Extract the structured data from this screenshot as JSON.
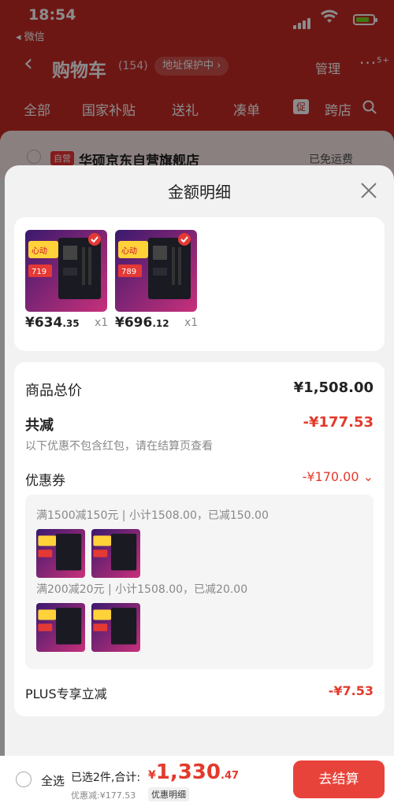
{
  "status": {
    "time": "18:54",
    "back_app": "◂ 微信"
  },
  "navbar": {
    "title": "购物车",
    "count": "(154)",
    "address_protect": "地址保护中",
    "manage": "管理",
    "more_badge": "5+"
  },
  "tabs": {
    "all": "全部",
    "national": "国家补贴",
    "gift": "送礼",
    "bundle": "凑单",
    "promo_badge": "促",
    "cross": "跨店"
  },
  "store": {
    "tag": "自营",
    "name": "华硕京东自营旗舰店",
    "shipping": "已免运费"
  },
  "sheet": {
    "title": "金额明细"
  },
  "products": [
    {
      "price_int": "¥634",
      "price_dec": ".35",
      "qty": "x1",
      "promo_price": "719"
    },
    {
      "price_int": "¥696",
      "price_dec": ".12",
      "qty": "x1",
      "promo_price": "789"
    }
  ],
  "summary": {
    "goods_total_label": "商品总价",
    "goods_total_value": "¥1,508.00",
    "discount_label": "共减",
    "discount_value": "-¥177.53",
    "note": "以下优惠不包含红包，请在结算页查看",
    "coupon_label": "优惠券",
    "coupon_value": "-¥170.00",
    "rule1": "满1500减150元 | 小计1508.00，已减150.00",
    "rule2": "满200减20元 | 小计1508.00，已减20.00",
    "plus_label": "PLUS专享立减",
    "plus_value": "-¥7.53"
  },
  "bottom": {
    "select_all": "全选",
    "selected": "已选2件,合计:",
    "currency": "¥",
    "total_int": "1,330",
    "total_dec": ".47",
    "discount_note": "优惠减:¥177.53",
    "detail": "优惠明细",
    "checkout": "去结算"
  },
  "colors": {
    "brand_red": "#c62a25",
    "price_red": "#e33a2c",
    "checkout_button": "#e8433a"
  }
}
